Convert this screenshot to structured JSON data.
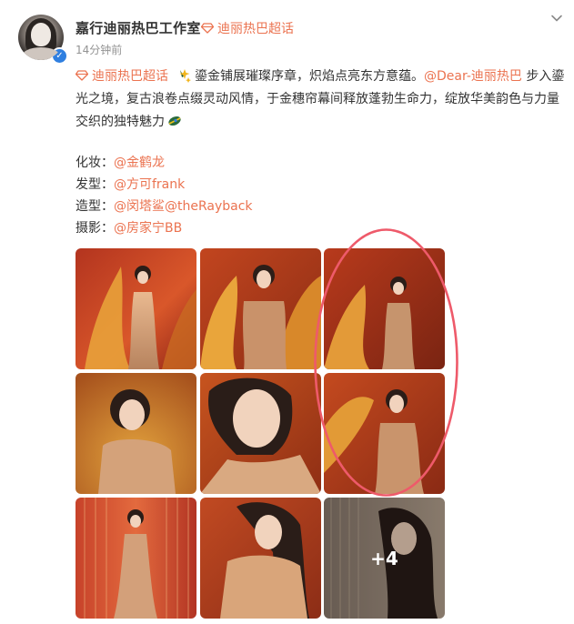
{
  "post": {
    "author": "嘉行迪丽热巴工作室",
    "supertopic_tag": "迪丽热巴超话",
    "time": "14分钟前",
    "icons": {
      "verified": "verified-badge-icon",
      "supertopic": "diamond-icon",
      "inline_emoji_1": "sparkle-emoji-icon",
      "inline_emoji_2": "leaf-emoji-icon",
      "menu": "chevron-down-icon"
    },
    "body": {
      "topic_link": "迪丽热巴超话",
      "text_part1": "鎏金铺展璀璨序章，炽焰点亮东方意蕴。",
      "mention": "@Dear-迪丽热巴",
      "text_part2": "步入鎏光之境，复古浪卷点缀灵动风情，于金穗帘幕间释放蓬勃生命力，绽放华美韵色与力量交织的独特魅力"
    },
    "credits": [
      {
        "label": "化妆：",
        "value": "@金鹤龙"
      },
      {
        "label": "发型：",
        "value": "@方可frank"
      },
      {
        "label": "造型：",
        "value": "@闵塔鲨@theRayback"
      },
      {
        "label": "摄影：",
        "value": "@房家宁BB"
      }
    ],
    "photos": {
      "more_count": "+4"
    }
  },
  "colors": {
    "accent": "#eb7350",
    "verify": "#2f7fe0",
    "annotation": "#ee5a6a"
  }
}
